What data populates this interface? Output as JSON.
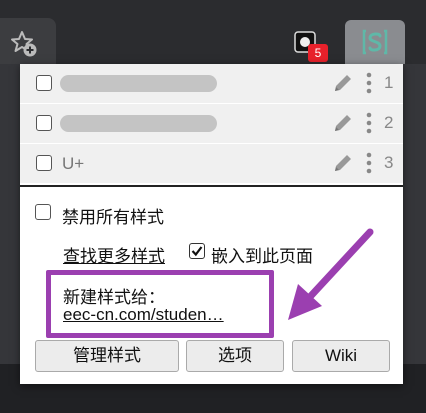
{
  "browser": {
    "extension_badge": "5"
  },
  "styles_list": [
    {
      "name": "",
      "index": "1",
      "blurred": true
    },
    {
      "name": "",
      "index": "2",
      "blurred": true
    },
    {
      "name": "U+",
      "index": "3",
      "blurred": false
    }
  ],
  "options": {
    "disable_all_label": "禁用所有样式",
    "find_more_label": "查找更多样式",
    "embed_label": "嵌入到此页面",
    "embed_checked": true
  },
  "new_style": {
    "label": "新建样式给：",
    "link": "eec-cn.com/studen…"
  },
  "buttons": {
    "manage": "管理样式",
    "options": "选项",
    "wiki": "Wiki"
  },
  "colors": {
    "annotation": "#9b3fb0",
    "badge": "#e8212b",
    "stylus_icon": "#5fb8a8"
  },
  "icons": [
    "star-add-icon",
    "extension-icon",
    "stylus-icon",
    "pencil-icon",
    "kebab-menu-icon",
    "checkmark-icon",
    "annotation-arrow"
  ]
}
